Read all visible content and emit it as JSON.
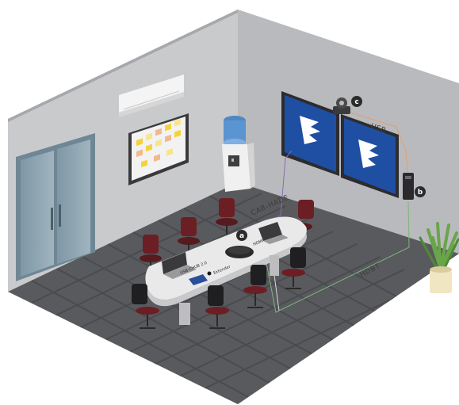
{
  "badges": {
    "a": "a",
    "b": "b",
    "c": "c"
  },
  "cables": {
    "usb": "USB",
    "cable_top": "CAB-HADE",
    "hdbt": "HDBT"
  },
  "devices": {
    "hub_label": "USB-CHUB 2.0",
    "hdmi_label": "HDMI",
    "wireless_label": "Extender"
  },
  "colors": {
    "wall_left": "#c9cacc",
    "wall_back": "#bdbec1",
    "floor": "#595a5e",
    "floor_tile": "#4a4b4f",
    "screen": "#1e4fa3",
    "chair": "#6b1f24",
    "badge": "#2b2b2b",
    "cable_purple": "#8b6bb1",
    "cable_orange": "#e0a070",
    "cable_green": "#7fb37f"
  }
}
